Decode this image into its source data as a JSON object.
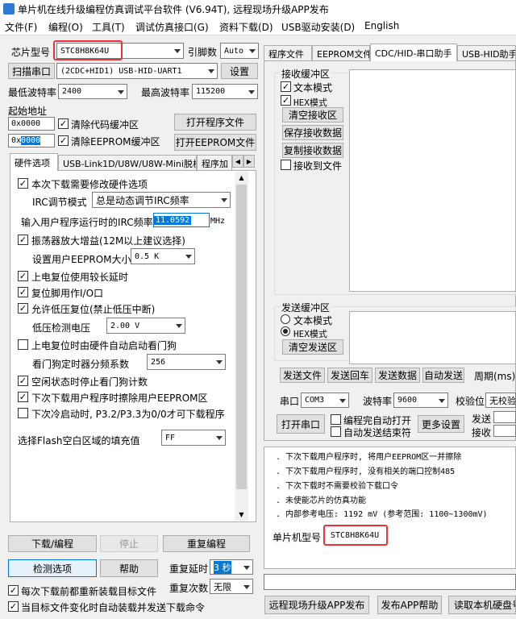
{
  "app": {
    "title": "单片机在线升级编程仿真调试平台软件 (V6.94T), 远程现场升级APP发布"
  },
  "menu": [
    "文件(F)",
    "编程(O)",
    "工具(T)",
    "调试仿真接口(G)",
    "资料下载(D)",
    "USB驱动安装(D)",
    "English"
  ],
  "left": {
    "chip_label": "芯片型号",
    "chip_value": "STC8H8K64U",
    "pins_label": "引脚数",
    "pins_value": "Auto",
    "scan_label": "扫描串口",
    "port_value": "(2CDC+HID1) USB-HID-UART1",
    "settings_label": "设置",
    "min_baud_label": "最低波特率",
    "min_baud_value": "2400",
    "max_baud_label": "最高波特率",
    "max_baud_value": "115200",
    "start_addr_label": "起始地址",
    "addr1_value": "0x0000",
    "clear_code_label": "清除代码缓冲区",
    "open_prog_label": "打开程序文件",
    "addr2_prefix": "0x",
    "addr2_value": "0000",
    "clear_eeprom_label": "清除EEPROM缓冲区",
    "open_eeprom_label": "打开EEPROM文件",
    "tabs": [
      "硬件选项",
      "USB-Link1D/U8W/U8W-Mini脱机",
      "程序加"
    ],
    "opt_redownload": "本次下载需要修改硬件选项",
    "irc_mode_label": "IRC调节模式",
    "irc_mode_value": "总是动态调节IRC频率",
    "irc_freq_label": "输入用户程序运行时的IRC频率",
    "irc_freq_value": "11.0592",
    "irc_unit": "MHz",
    "opt_osc": "振荡器放大增益(12M以上建议选择)",
    "eeprom_size_label": "设置用户EEPROM大小",
    "eeprom_size_value": "0.5 K",
    "opt_poweron": "上电复位使用较长延时",
    "opt_resetpin": "复位脚用作I/O口",
    "opt_lvr": "允许低压复位(禁止低压中断)",
    "lvr_label": "低压检测电压",
    "lvr_value": "2.00 V",
    "opt_wdt": "上电复位时由硬件自动启动看门狗",
    "wdt_label": "看门狗定时器分频系数",
    "wdt_value": "256",
    "opt_idle_wdt": "空闲状态时停止看门狗计数",
    "opt_eeprom_erase": "下次下载用户程序时擦除用户EEPROM区",
    "opt_cold": "下次冷启动时, P3.2/P3.3为0/0才可下载程序",
    "fill_label": "选择Flash空白区域的填充值",
    "fill_value": "FF",
    "download_label": "下载/编程",
    "stop_label": "停止",
    "reprogram_label": "重复编程",
    "check_label": "检测选项",
    "help_label": "帮助",
    "repeat_delay_label": "重复延时",
    "repeat_delay_value": "3 秒",
    "repeat_count_label": "重复次数",
    "repeat_count_value": "无限",
    "opt_reload": "每次下载前都重新装载目标文件",
    "opt_autosend": "当目标文件变化时自动装载并发送下载命令"
  },
  "right": {
    "tabs": [
      "程序文件",
      "EEPROM文件",
      "CDC/HID-串口助手",
      "USB-HID助手"
    ],
    "recv_group": "接收缓冲区",
    "recv_text": "文本模式",
    "recv_hex": "HEX模式",
    "clear_recv": "清空接收区",
    "save_recv": "保存接收数据",
    "copy_recv": "复制接收数据",
    "recv_file": "接收到文件",
    "send_group": "发送缓冲区",
    "send_text": "文本模式",
    "send_hex": "HEX模式",
    "clear_send": "清空发送区",
    "send_file": "发送文件",
    "send_enter": "发送回车",
    "send_data": "发送数据",
    "auto_send": "自动发送",
    "period_label": "周期(ms)",
    "port_label": "串口",
    "port_value": "COM3",
    "baud_label": "波特率",
    "baud_value": "9600",
    "parity_label": "校验位",
    "parity_value": "无校验",
    "open_port": "打开串口",
    "opt_auto_open": "编程完自动打开",
    "opt_auto_end": "自动发送结束符",
    "more_settings": "更多设置",
    "send_counter": "发送",
    "recv_counter": "接收"
  },
  "log": {
    "lines": [
      ". 下次下载用户程序时, 将用户EEPROM区一并擦除",
      ". 下次下载用户程序时, 没有相关的端口控制485",
      ". 下次下载时不需要校验下载口令",
      ". 未使能芯片的仿真功能",
      ". 内部参考电压: 1192 mV (参考范围: 1100~1300mV)"
    ],
    "chip_label": "单片机型号",
    "chip_value": "STC8H8K64U"
  },
  "bottom": {
    "publish_app": "远程现场升级APP发布",
    "publish_help": "发布APP帮助",
    "read_disk": "读取本机硬盘号"
  },
  "colors": {
    "highlight": "#e8333c",
    "selection": "#0078d7"
  }
}
